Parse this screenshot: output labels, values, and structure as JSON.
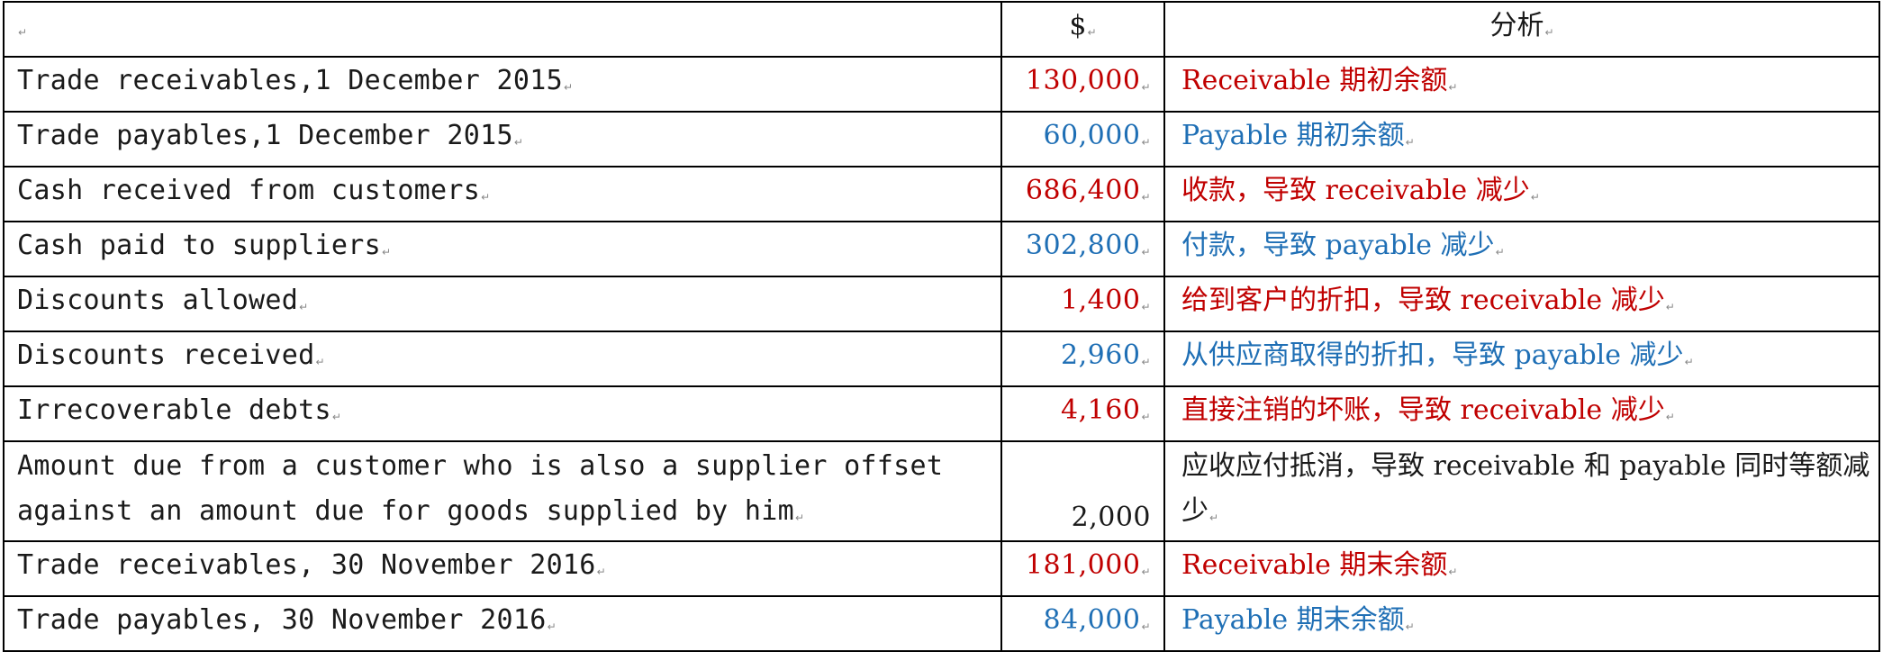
{
  "header": {
    "item": "",
    "amount": "$",
    "analysis": "分析"
  },
  "colors": {
    "receivable": "#c00000",
    "payable": "#1f6fb5",
    "neutral": "#1a1a1a"
  },
  "rows": [
    {
      "item": "Trade receivables,1 December 2015",
      "amount": "130,000",
      "analysis": "Receivable 期初余额",
      "color": "#c00000"
    },
    {
      "item": "Trade payables,1 December 2015",
      "amount": "60,000",
      "analysis": "Payable 期初余额",
      "color": "#1f6fb5"
    },
    {
      "item": "Cash received from customers",
      "amount": "686,400",
      "analysis": "收款，导致 receivable 减少",
      "color": "#c00000"
    },
    {
      "item": "Cash paid to suppliers",
      "amount": "302,800",
      "analysis": "付款，导致 payable 减少",
      "color": "#1f6fb5"
    },
    {
      "item": "Discounts allowed",
      "amount": "1,400",
      "analysis": "给到客户的折扣，导致 receivable 减少",
      "color": "#c00000"
    },
    {
      "item": "Discounts received",
      "amount": "2,960",
      "analysis": "从供应商取得的折扣，导致 payable 减少",
      "color": "#1f6fb5"
    },
    {
      "item": "Irrecoverable debts",
      "amount": "4,160",
      "analysis": "直接注销的坏账，导致 receivable 减少",
      "color": "#c00000"
    },
    {
      "item": "Amount due from a customer who is also a supplier offset against an amount due for goods supplied by him",
      "amount": "2,000",
      "analysis": "应收应付抵消，导致 receivable 和 payable 同时等额减少",
      "color": "#1a1a1a"
    },
    {
      "item": "Trade receivables, 30 November 2016",
      "amount": "181,000",
      "analysis": "Receivable 期末余额",
      "color": "#c00000"
    },
    {
      "item": "Trade payables, 30 November 2016",
      "amount": "84,000",
      "analysis": "Payable 期末余额",
      "color": "#1f6fb5"
    }
  ]
}
